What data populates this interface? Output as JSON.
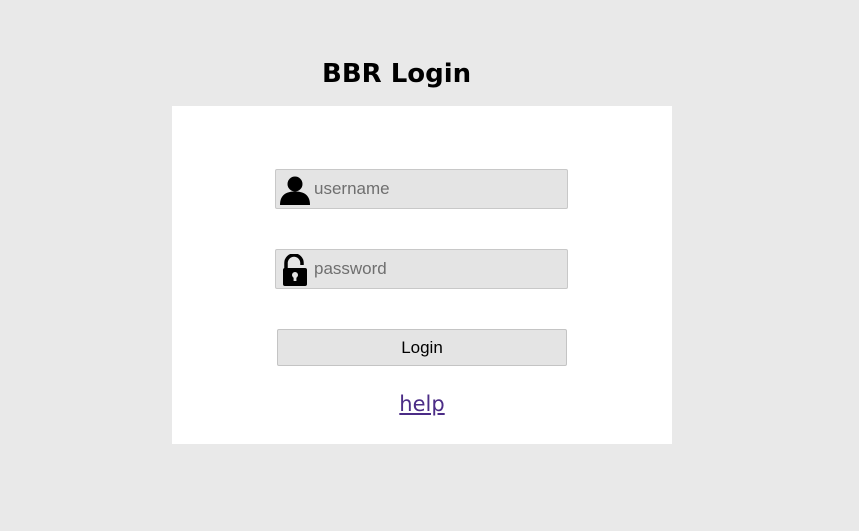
{
  "page": {
    "title": "BBR Login"
  },
  "form": {
    "username": {
      "placeholder": "username",
      "value": "",
      "icon": "user-icon"
    },
    "password": {
      "placeholder": "password",
      "value": "",
      "icon": "padlock-icon"
    },
    "login_label": "Login",
    "help_label": "help"
  },
  "colors": {
    "background": "#e9e9e9",
    "panel": "#ffffff",
    "field": "#e4e4e4",
    "link": "#4b2c86"
  }
}
